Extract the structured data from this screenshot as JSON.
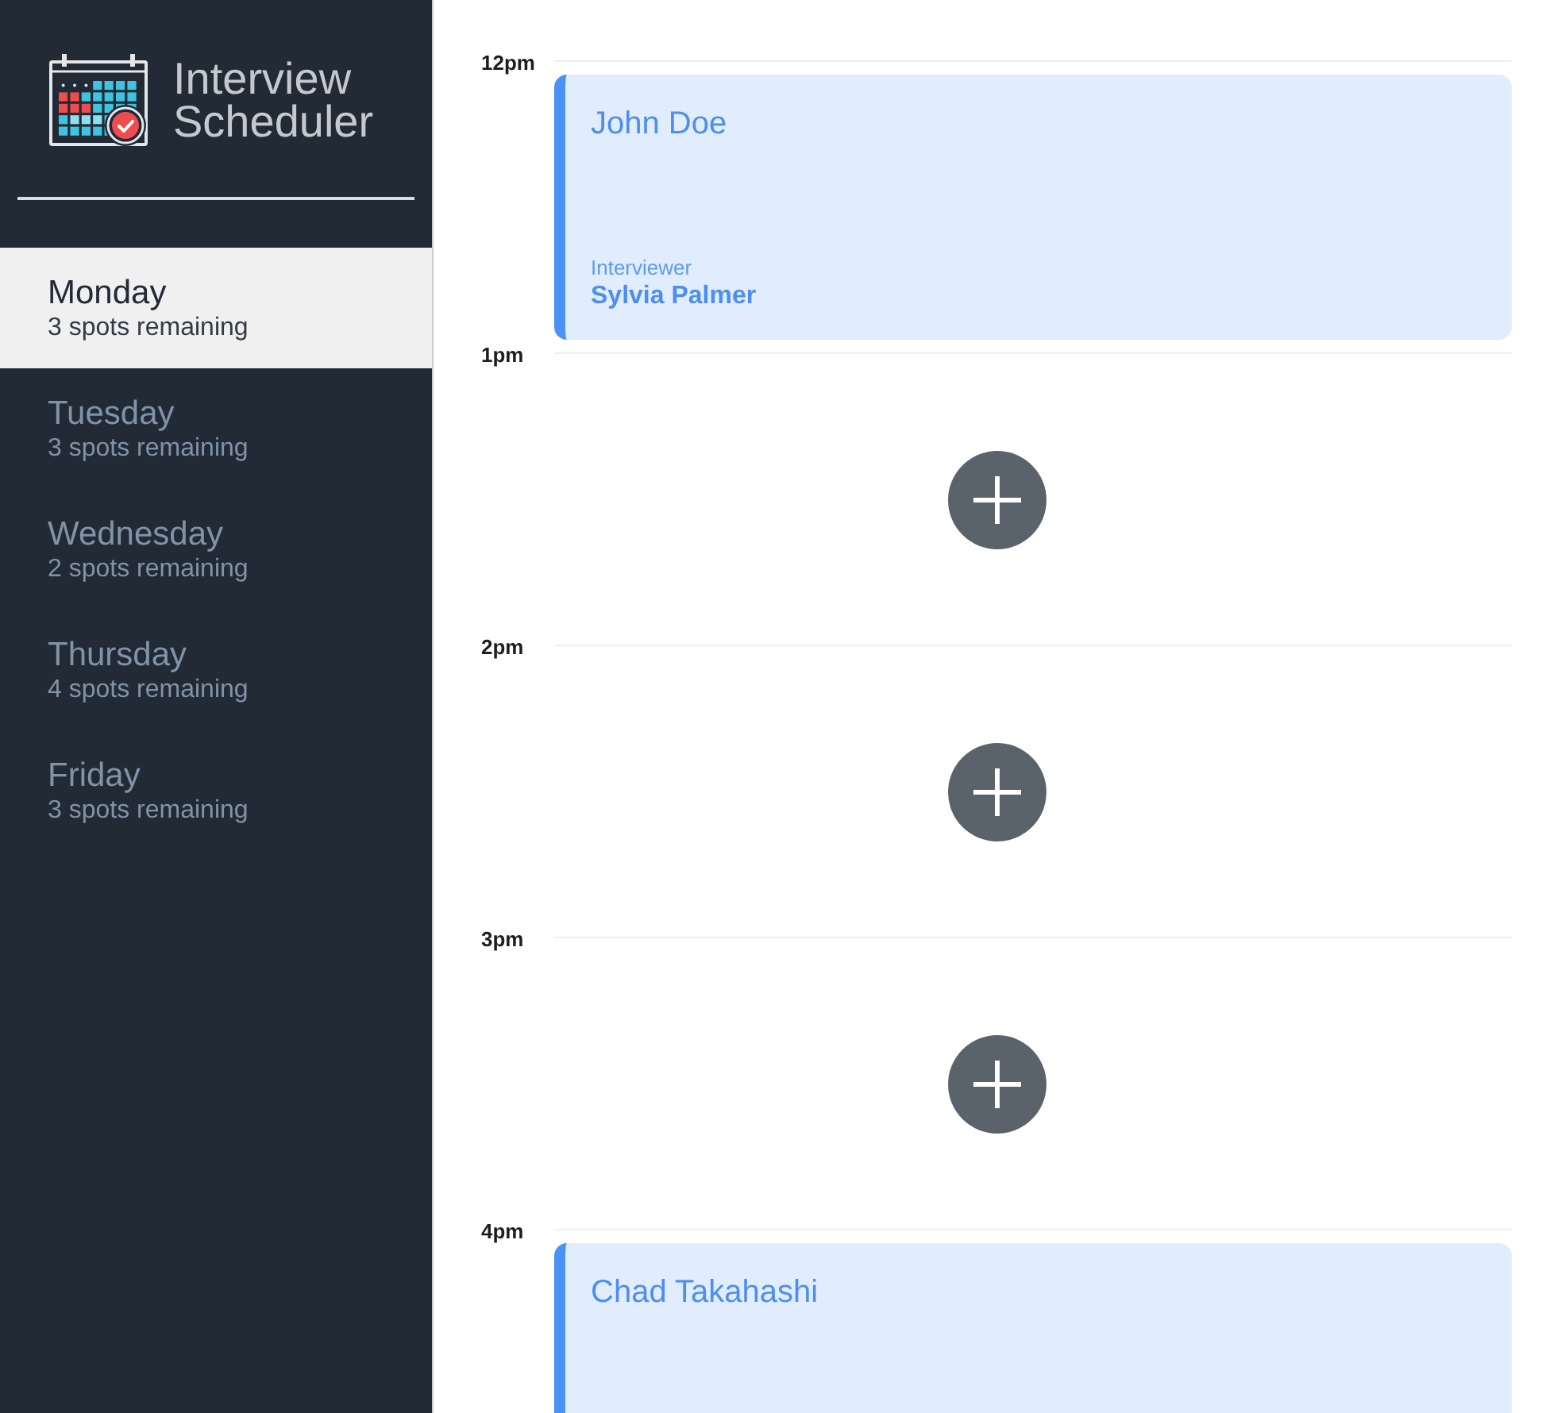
{
  "app": {
    "title": "Interview Scheduler"
  },
  "days": [
    {
      "name": "Monday",
      "spots": "3 spots remaining",
      "selected": true
    },
    {
      "name": "Tuesday",
      "spots": "3 spots remaining",
      "selected": false
    },
    {
      "name": "Wednesday",
      "spots": "2 spots remaining",
      "selected": false
    },
    {
      "name": "Thursday",
      "spots": "4 spots remaining",
      "selected": false
    },
    {
      "name": "Friday",
      "spots": "3 spots remaining",
      "selected": false
    }
  ],
  "schedule": [
    {
      "time": "12pm",
      "kind": "booked",
      "appointment": {
        "student": "John Doe",
        "interviewer_label": "Interviewer",
        "interviewer": "Sylvia Palmer"
      }
    },
    {
      "time": "1pm",
      "kind": "empty"
    },
    {
      "time": "2pm",
      "kind": "empty"
    },
    {
      "time": "3pm",
      "kind": "empty"
    },
    {
      "time": "4pm",
      "kind": "booked",
      "appointment": {
        "student": "Chad Takahashi"
      }
    }
  ]
}
